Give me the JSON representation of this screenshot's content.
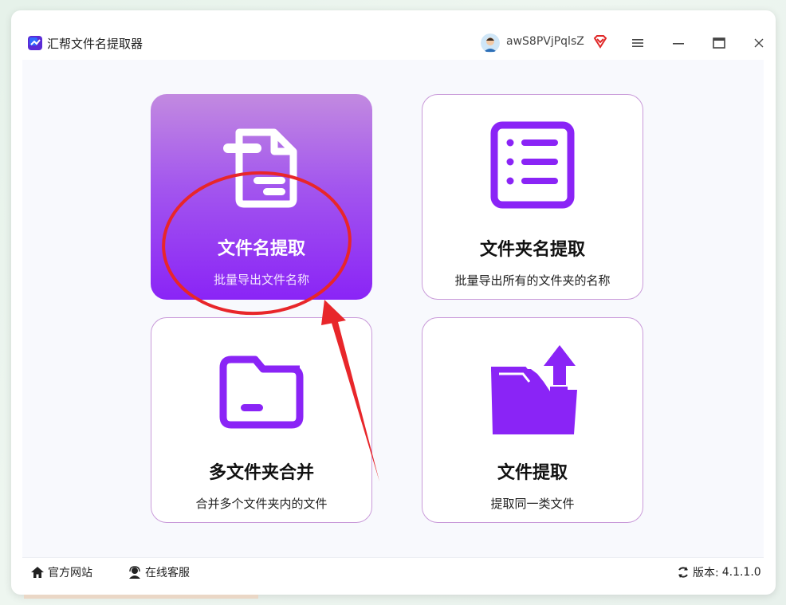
{
  "app": {
    "title": "汇帮文件名提取器",
    "username": "awS8PVjPqlsZ"
  },
  "cards": [
    {
      "title": "文件名提取",
      "desc": "批量导出文件名称"
    },
    {
      "title": "文件夹名提取",
      "desc": "批量导出所有的文件夹的名称"
    },
    {
      "title": "多文件夹合并",
      "desc": "合并多个文件夹内的文件"
    },
    {
      "title": "文件提取",
      "desc": "提取同一类文件"
    }
  ],
  "status": {
    "website": "官方网站",
    "support": "在线客服",
    "version_label": "版本:",
    "version": "4.1.1.0"
  },
  "colors": {
    "accent": "#8a24f6",
    "annotation_red": "#e8262a"
  }
}
